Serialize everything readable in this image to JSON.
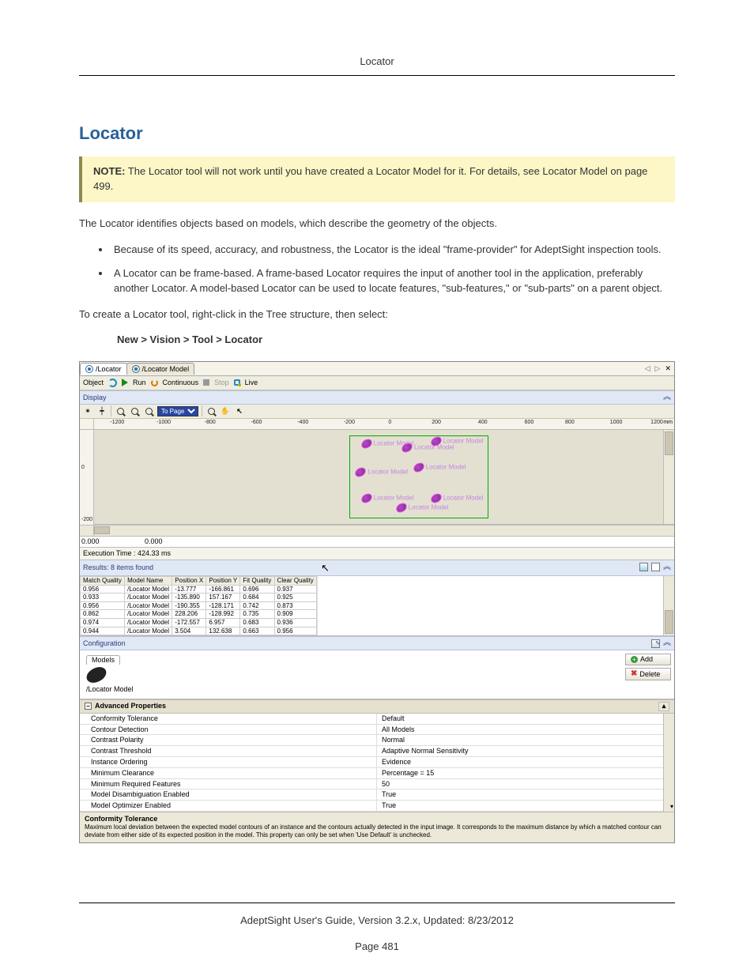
{
  "running_head": "Locator",
  "title": "Locator",
  "note_label": "NOTE:",
  "note_text": " The Locator tool will not work until you have created a Locator Model for it. For details, see Locator Model on page 499.",
  "intro": "The Locator identifies objects based on models, which describe the geometry of the objects.",
  "bullets": [
    "Because of its speed, accuracy, and robustness, the Locator is the ideal \"frame-provider\" for AdeptSight inspection tools.",
    "A Locator can be frame-based. A frame-based Locator requires the input of another tool in the application, preferably another Locator. A model-based Locator can be used to locate features, \"sub-features,\" or \"sub-parts\" on a parent object."
  ],
  "create_text": "To create a Locator tool, right-click in the Tree structure, then select:",
  "menu_path": "New > Vision > Tool > Locator",
  "shot": {
    "tab1": "/Locator",
    "tab2": "/Locator Model",
    "object_label": "Object",
    "run": "Run",
    "continuous": "Continuous",
    "stop": "Stop",
    "live": "Live",
    "display": "Display",
    "topage": "To Page",
    "ruler_x": [
      "-1200",
      "-1000",
      "-800",
      "-600",
      "-400",
      "-200",
      "0",
      "200",
      "400",
      "600",
      "800",
      "1000",
      "1200"
    ],
    "ruler_y_top": "0",
    "ruler_y_bot": "-200",
    "mm": "mm",
    "model_label": "Locator Model",
    "coord1": "0.000",
    "coord2": "0.000",
    "exec_time": "Execution Time : 424.33 ms",
    "results_head": "Results: 8 items found",
    "cols": [
      "Match Quality",
      "Model Name",
      "Position X",
      "Position Y",
      "Fit Quality",
      "Clear Quality"
    ],
    "rows": [
      [
        "0.956",
        "/Locator Model",
        "-13.777",
        "-166.861",
        "0.696",
        "0.937"
      ],
      [
        "0.933",
        "/Locator Model",
        "-135.890",
        "157.167",
        "0.684",
        "0.925"
      ],
      [
        "0.956",
        "/Locator Model",
        "-190.355",
        "-128.171",
        "0.742",
        "0.873"
      ],
      [
        "0.862",
        "/Locator Model",
        "228.206",
        "-128.992",
        "0.735",
        "0.909"
      ],
      [
        "0.974",
        "/Locator Model",
        "-172.557",
        "6.957",
        "0.683",
        "0.936"
      ],
      [
        "0.944",
        "/Locator Model",
        "3.504",
        "132.638",
        "0.663",
        "0.956"
      ]
    ],
    "config": "Configuration",
    "models_tab": "Models",
    "model_name": "/Locator Model",
    "add": "Add",
    "delete": "Delete",
    "adv_head": "Advanced Properties",
    "adv_rows": [
      [
        "Conformity Tolerance",
        "Default"
      ],
      [
        "Contour Detection",
        "All Models"
      ],
      [
        "Contrast Polarity",
        "Normal"
      ],
      [
        "Contrast Threshold",
        "Adaptive Normal Sensitivity"
      ],
      [
        "Instance Ordering",
        "Evidence"
      ],
      [
        "Minimum Clearance",
        "Percentage = 15"
      ],
      [
        "Minimum Required Features",
        "50"
      ],
      [
        "Model Disambiguation Enabled",
        "True"
      ],
      [
        "Model Optimizer Enabled",
        "True"
      ]
    ],
    "help_title": "Conformity Tolerance",
    "help_desc": "Maximum local deviation between the expected model contours of an instance and the contours actually detected in the input image. It corresponds to the maximum distance by which a matched contour can deviate from either side of its expected position in the model. This property can only be set when 'Use Default' is unchecked."
  },
  "footer": "AdeptSight User's Guide,  Version 3.2.x, Updated: 8/23/2012",
  "page_no": "Page 481"
}
